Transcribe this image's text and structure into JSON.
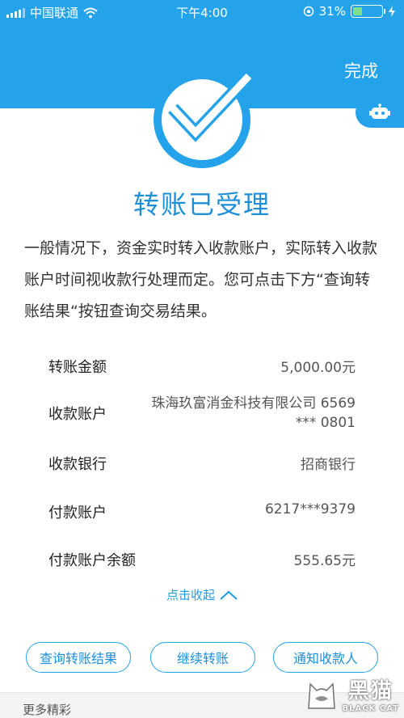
{
  "status_bar": {
    "carrier": "中国联通",
    "time": "下午4:00",
    "battery_percent": "31%",
    "battery_level": 0.31,
    "icons": [
      "signal-icon",
      "wifi-icon",
      "orientation-lock-icon",
      "battery-icon",
      "charging-icon"
    ]
  },
  "header": {
    "done_label": "完成"
  },
  "title": "转账已受理",
  "description": "一般情况下，资金实时转入收款账户，实际转入收款账户时间视收款行处理而定。您可点击下方“查询转账结果“按钮查询交易结果。",
  "details": [
    {
      "label": "转账金额",
      "value": "5,000.00元"
    },
    {
      "label": "收款账户",
      "value_line1": "珠海玖富消金科技有限公司 6569",
      "value_line2": "*** 0801"
    },
    {
      "label": "收款银行",
      "value": "招商银行"
    },
    {
      "label": "付款账户",
      "value": "6217***9379"
    },
    {
      "label": "付款账户余额",
      "value": "555.65元"
    }
  ],
  "collapse_label": "点击收起",
  "buttons": {
    "query": "查询转账结果",
    "continue": "继续转账",
    "notify": "通知收款人"
  },
  "more_label": "更多精彩",
  "watermark": {
    "cn": "黑猫",
    "en": "BLACK CAT"
  },
  "colors": {
    "primary": "#25a3ea",
    "title": "#1d8fd9"
  }
}
